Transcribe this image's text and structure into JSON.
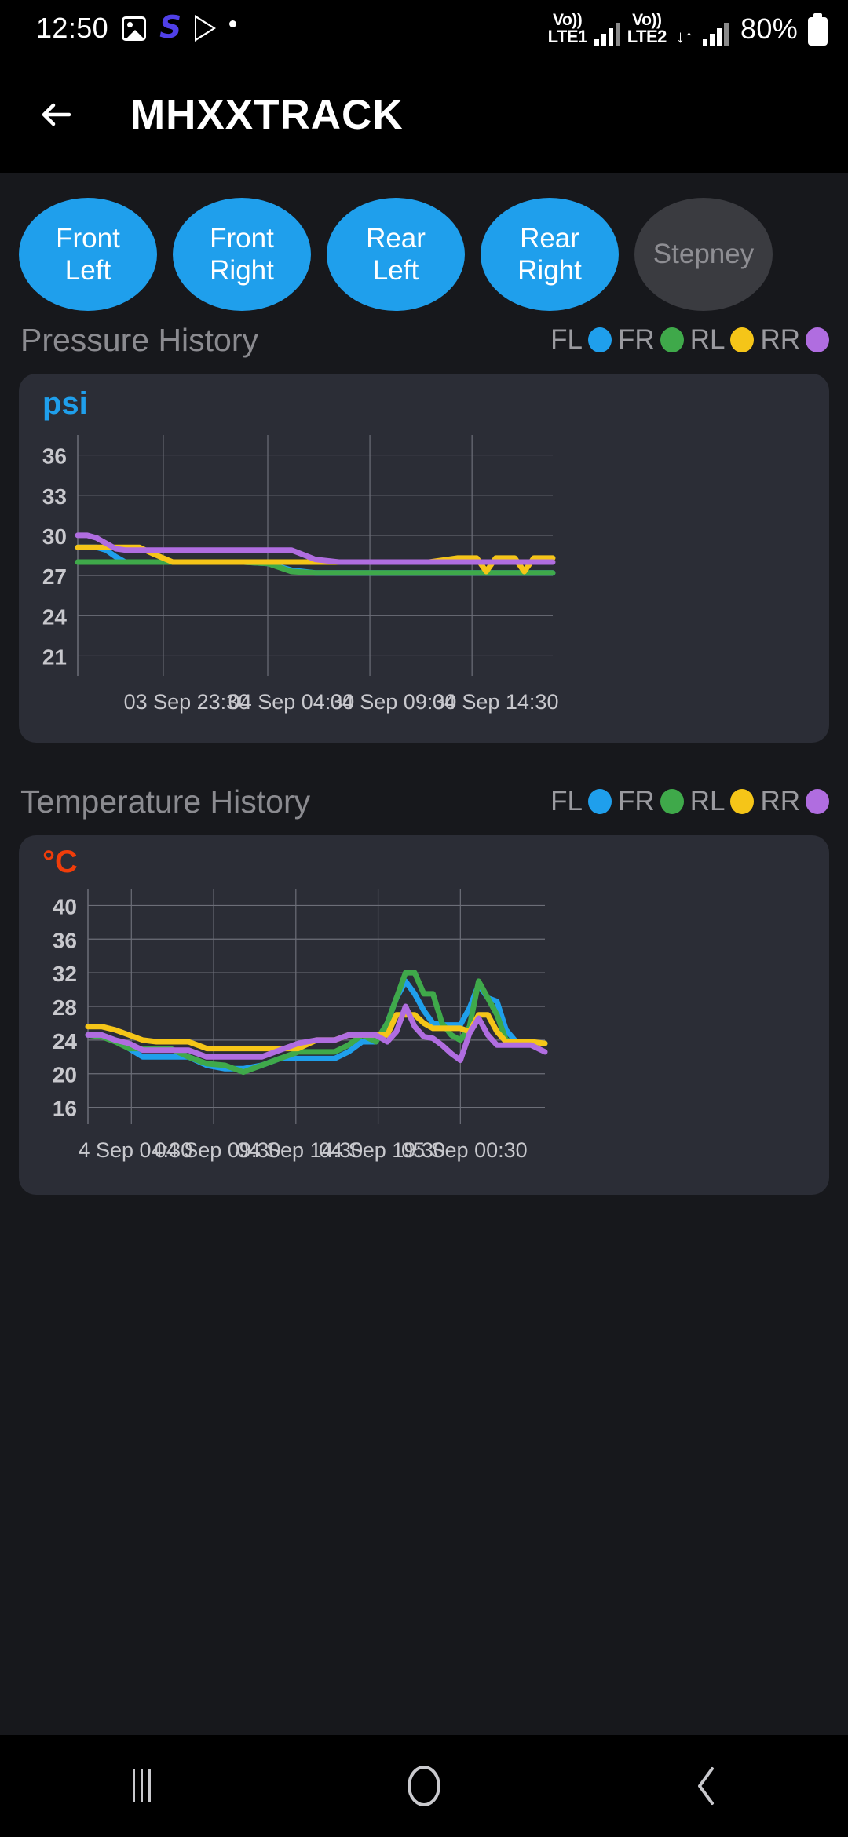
{
  "statusbar": {
    "clock": "12:50",
    "icons": [
      "photos-icon",
      "samsung-s-icon",
      "play-store-icon",
      "more-dot-icon"
    ],
    "sim1_volte": "Vo))",
    "sim1_label": "LTE1",
    "sim2_volte": "Vo))",
    "sim2_label": "LTE2",
    "lte_label": "LTE",
    "lte_arrows": "↓↑",
    "battery_percent": "80%"
  },
  "appbar": {
    "back_icon": "back-arrow-icon",
    "title": "MHXXTRACK"
  },
  "tire_pills": [
    {
      "line1": "Front",
      "line2": "Left",
      "state": "active"
    },
    {
      "line1": "Front",
      "line2": "Right",
      "state": "active"
    },
    {
      "line1": "Rear",
      "line2": "Left",
      "state": "active"
    },
    {
      "line1": "Rear",
      "line2": "Right",
      "state": "active"
    },
    {
      "line1": "Stepney",
      "line2": "",
      "state": "inactive"
    }
  ],
  "colors": {
    "accent_blue": "#1f9fec",
    "fl": "#1f9fec",
    "fr": "#3fa94a",
    "rl": "#f5c518",
    "rr": "#b06de0",
    "pill_inactive": "#3a3b40",
    "card_bg": "#2b2d36",
    "page_bg": "#17181c",
    "unit_psi": "#1f9fec",
    "unit_celsius": "#f03d0a"
  },
  "legend": [
    {
      "label": "FL",
      "color": "#1f9fec"
    },
    {
      "label": "FR",
      "color": "#3fa94a"
    },
    {
      "label": "RL",
      "color": "#f5c518"
    },
    {
      "label": "RR",
      "color": "#b06de0"
    }
  ],
  "pressure_section": {
    "title": "Pressure History",
    "unit": "psi"
  },
  "temperature_section": {
    "title": "Temperature History",
    "unit": "°C"
  },
  "navbar": {
    "recents": "recent-apps-icon",
    "home": "home-icon",
    "back": "back-icon"
  },
  "chart_data": [
    {
      "id": "pressure",
      "type": "line",
      "title": "Pressure History",
      "ylabel": "psi",
      "xlabel": "",
      "ylim": [
        19.5,
        37.5
      ],
      "yticks": [
        36,
        33,
        30,
        27,
        24,
        21
      ],
      "grid": true,
      "legend_position": "top-right",
      "xticks": [
        "03 Sep 23:30",
        "04 Sep 04:30",
        "04 Sep 09:30",
        "04 Sep 14:30"
      ],
      "xtick_fractions": [
        0.18,
        0.4,
        0.615,
        0.83
      ],
      "x": [
        0,
        0.02,
        0.04,
        0.06,
        0.08,
        0.1,
        0.13,
        0.16,
        0.2,
        0.25,
        0.3,
        0.35,
        0.4,
        0.45,
        0.5,
        0.55,
        0.6,
        0.62,
        0.66,
        0.7,
        0.74,
        0.78,
        0.8,
        0.82,
        0.84,
        0.86,
        0.88,
        0.9,
        0.92,
        0.94,
        0.96,
        0.98,
        1.0
      ],
      "series": [
        {
          "name": "FL",
          "color": "#1f9fec",
          "values": [
            29.1,
            29.1,
            29.1,
            28.9,
            28.4,
            28.0,
            28.0,
            28.0,
            28.0,
            28.0,
            28.0,
            28.0,
            27.9,
            27.4,
            27.2,
            27.2,
            27.2,
            27.2,
            27.2,
            27.2,
            27.2,
            27.2,
            27.2,
            27.2,
            27.2,
            27.2,
            27.2,
            27.2,
            27.2,
            27.2,
            27.2,
            27.2,
            27.2
          ]
        },
        {
          "name": "FR",
          "color": "#3fa94a",
          "values": [
            28.0,
            28.0,
            28.0,
            28.0,
            28.0,
            28.0,
            28.0,
            28.0,
            28.0,
            28.0,
            28.0,
            28.0,
            27.9,
            27.3,
            27.2,
            27.2,
            27.2,
            27.2,
            27.2,
            27.2,
            27.2,
            27.2,
            27.2,
            27.2,
            27.2,
            27.2,
            27.2,
            27.2,
            27.2,
            27.2,
            27.2,
            27.2,
            27.2
          ]
        },
        {
          "name": "RL",
          "color": "#f5c518",
          "values": [
            29.1,
            29.1,
            29.1,
            29.1,
            29.1,
            29.1,
            29.1,
            28.6,
            28.0,
            28.0,
            28.0,
            28.0,
            28.0,
            28.0,
            28.0,
            28.0,
            28.0,
            28.0,
            28.0,
            28.0,
            28.0,
            28.2,
            28.3,
            28.3,
            28.3,
            27.3,
            28.3,
            28.3,
            28.3,
            27.3,
            28.3,
            28.3,
            28.3
          ]
        },
        {
          "name": "RR",
          "color": "#b06de0",
          "values": [
            30.0,
            30.0,
            29.8,
            29.4,
            29.0,
            28.9,
            28.9,
            28.9,
            28.9,
            28.9,
            28.9,
            28.9,
            28.9,
            28.9,
            28.2,
            28.0,
            28.0,
            28.0,
            28.0,
            28.0,
            28.0,
            28.0,
            28.0,
            28.0,
            28.0,
            28.0,
            28.0,
            28.0,
            28.0,
            28.0,
            28.0,
            28.0,
            28.0
          ]
        }
      ]
    },
    {
      "id": "temperature",
      "type": "line",
      "title": "Temperature History",
      "ylabel": "°C",
      "xlabel": "",
      "ylim": [
        14,
        42
      ],
      "yticks": [
        40,
        36,
        32,
        28,
        24,
        20,
        16
      ],
      "grid": true,
      "legend_position": "top-right",
      "xticks": [
        "4 Sep 04:30",
        "04 Sep 09:30",
        "04 Sep 14:30",
        "04 Sep 19:30",
        "05 Sep 00:30"
      ],
      "xtick_fractions": [
        0.095,
        0.275,
        0.455,
        0.635,
        0.815
      ],
      "x": [
        0,
        0.03,
        0.06,
        0.09,
        0.12,
        0.15,
        0.18,
        0.22,
        0.26,
        0.3,
        0.34,
        0.38,
        0.42,
        0.46,
        0.5,
        0.54,
        0.57,
        0.6,
        0.63,
        0.655,
        0.675,
        0.695,
        0.715,
        0.735,
        0.755,
        0.775,
        0.795,
        0.815,
        0.835,
        0.855,
        0.875,
        0.895,
        0.915,
        0.94,
        0.97,
        1.0
      ],
      "series": [
        {
          "name": "FL",
          "color": "#1f9fec",
          "values": [
            24.6,
            24.6,
            24.0,
            23.0,
            22.0,
            22.0,
            22.0,
            22.0,
            21.0,
            20.6,
            20.6,
            21.0,
            21.8,
            21.8,
            21.8,
            21.8,
            22.6,
            23.8,
            23.8,
            26.0,
            29.0,
            31.0,
            29.5,
            27.5,
            26.0,
            25.8,
            25.8,
            25.8,
            27.8,
            30.6,
            29.0,
            28.6,
            25.2,
            23.6,
            23.6,
            23.6
          ]
        },
        {
          "name": "FR",
          "color": "#3fa94a",
          "values": [
            24.6,
            24.4,
            23.8,
            23.0,
            23.0,
            23.0,
            23.0,
            22.0,
            21.2,
            21.0,
            20.2,
            21.0,
            21.8,
            22.6,
            22.6,
            22.6,
            23.4,
            24.6,
            23.8,
            26.0,
            29.0,
            32.0,
            32.0,
            29.5,
            29.5,
            26.0,
            24.6,
            24.0,
            25.6,
            31.0,
            29.0,
            27.0,
            24.0,
            23.6,
            23.6,
            23.6
          ]
        },
        {
          "name": "RL",
          "color": "#f5c518",
          "values": [
            25.6,
            25.6,
            25.2,
            24.6,
            24.0,
            23.8,
            23.8,
            23.8,
            23.0,
            23.0,
            23.0,
            23.0,
            23.0,
            23.0,
            24.0,
            24.0,
            24.6,
            24.6,
            24.6,
            24.6,
            27.0,
            27.0,
            27.0,
            26.0,
            25.4,
            25.4,
            25.4,
            25.4,
            25.0,
            27.0,
            27.0,
            25.0,
            23.8,
            23.8,
            23.8,
            23.6
          ]
        },
        {
          "name": "RR",
          "color": "#b06de0",
          "values": [
            24.6,
            24.6,
            24.0,
            23.6,
            22.8,
            22.8,
            22.8,
            22.8,
            22.0,
            22.0,
            22.0,
            22.0,
            22.8,
            23.6,
            24.0,
            24.0,
            24.6,
            24.6,
            24.6,
            23.8,
            25.0,
            28.0,
            25.6,
            24.4,
            24.2,
            23.4,
            22.4,
            21.6,
            24.8,
            26.6,
            24.6,
            23.4,
            23.4,
            23.4,
            23.4,
            22.6
          ]
        }
      ]
    }
  ]
}
